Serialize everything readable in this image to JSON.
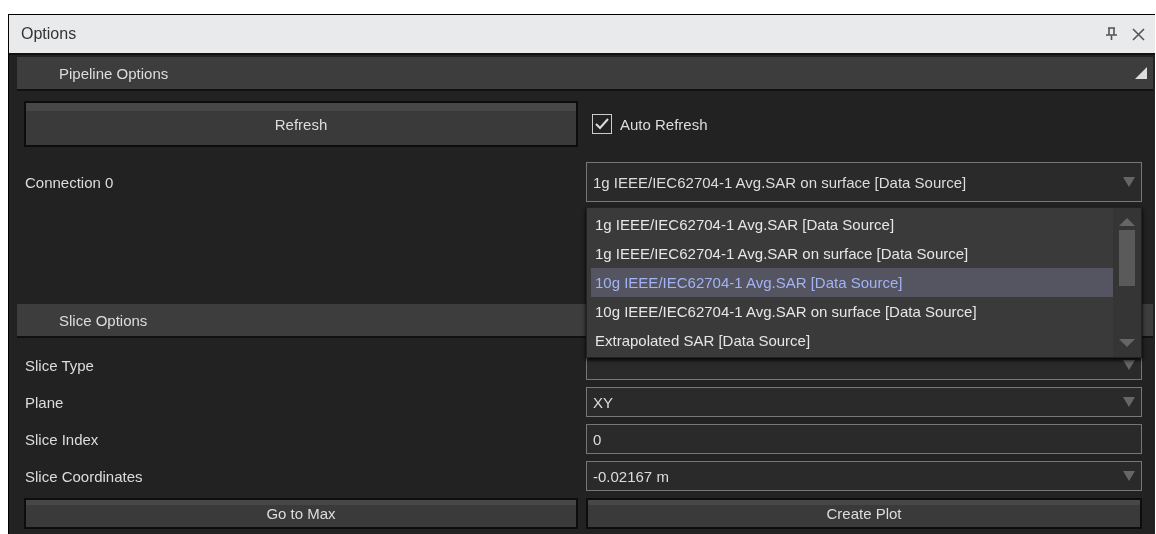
{
  "window": {
    "title": "Options"
  },
  "pipeline_options": {
    "header": "Pipeline Options",
    "expanded": true,
    "refresh_button": "Refresh",
    "auto_refresh": {
      "label": "Auto Refresh",
      "checked": true
    },
    "connection": {
      "label": "Connection 0",
      "value": "1g IEEE/IEC62704-1 Avg.SAR on surface [Data Source]",
      "open": true,
      "items": [
        {
          "label": "1g IEEE/IEC62704-1 Avg.SAR [Data Source]",
          "highlighted": false
        },
        {
          "label": "1g IEEE/IEC62704-1 Avg.SAR on surface [Data Source]",
          "highlighted": false
        },
        {
          "label": "10g IEEE/IEC62704-1 Avg.SAR [Data Source]",
          "highlighted": true
        },
        {
          "label": "10g IEEE/IEC62704-1 Avg.SAR on surface [Data Source]",
          "highlighted": false
        },
        {
          "label": "Extrapolated SAR [Data Source]",
          "highlighted": false
        }
      ]
    }
  },
  "slice_options": {
    "header": "Slice Options",
    "rows": [
      {
        "label": "Slice Type",
        "kind": "dropdown"
      },
      {
        "label": "Plane",
        "kind": "dropdown",
        "value": "XY"
      },
      {
        "label": "Slice Index",
        "kind": "text",
        "value": "0"
      },
      {
        "label": "Slice Coordinates",
        "kind": "dropdown",
        "value": "-0.02167 m"
      }
    ],
    "buttons": [
      "Go to Max",
      "Create Plot"
    ]
  }
}
